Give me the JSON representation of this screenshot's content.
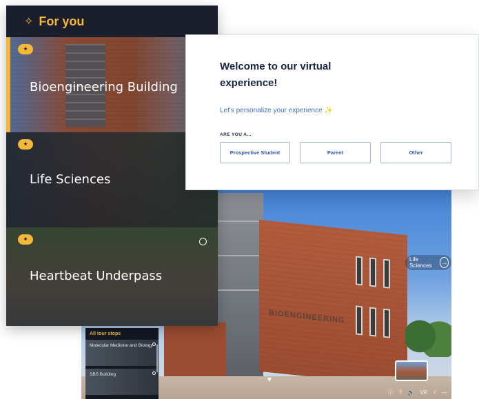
{
  "for_you": {
    "header": "For you",
    "sparkle_icon": "sparkles-icon",
    "cards": [
      {
        "title": "Bioengineering Building",
        "badge_icon": "sparkle-badge-icon"
      },
      {
        "title": "Life Sciences",
        "badge_icon": "sparkle-badge-icon"
      },
      {
        "title": "Heartbeat Underpass",
        "badge_icon": "sparkle-badge-icon"
      }
    ]
  },
  "welcome": {
    "title": "Welcome to our virtual experience!",
    "subtitle": "Let's personalize your experience",
    "question": "ARE YOU A...",
    "options": [
      "Prospective Student",
      "Parent",
      "Other"
    ]
  },
  "viewer": {
    "building_sign": "BIOENGINEERING",
    "next_stop": "Life Sciences",
    "stops_panel": {
      "header": "All tour stops",
      "stops": [
        "Molecular Medicine and Biology",
        "SBS Building"
      ]
    },
    "toolbar_icons": [
      "info-icon",
      "help-icon",
      "volume-icon",
      "vr-icon",
      "share-icon",
      "minimize-icon"
    ],
    "toolbar_glyphs": [
      "ⓘ",
      "?",
      "🔊",
      "VR",
      "<",
      "—"
    ]
  },
  "colors": {
    "accent": "#f4b73a",
    "panel_bg": "#1a1f2b",
    "button_text": "#2c58a8",
    "title_text": "#1a2340"
  }
}
